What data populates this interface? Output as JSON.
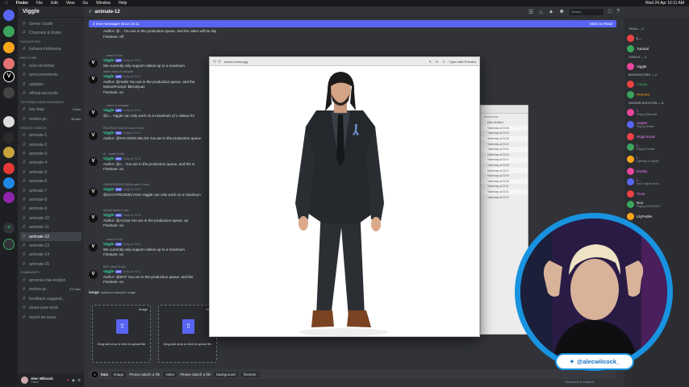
{
  "menubar": {
    "app": "Finder",
    "items": [
      "File",
      "Edit",
      "View",
      "Go",
      "Window",
      "Help"
    ],
    "clock": "Wed 24 Apr 10:11 AM"
  },
  "server": {
    "name": "Viggle"
  },
  "channels": [
    {
      "kind": "ch",
      "label": "Server Guide"
    },
    {
      "kind": "ch",
      "label": "Channels & Roles"
    },
    {
      "kind": "cat",
      "label": "SUGGESTED"
    },
    {
      "kind": "ch",
      "label": "bahasa-indonesia"
    },
    {
      "kind": "cat",
      "label": "WELCOME"
    },
    {
      "kind": "ch",
      "label": "rules-to-follow"
    },
    {
      "kind": "ch",
      "label": "announcements"
    },
    {
      "kind": "ch",
      "label": "updates"
    },
    {
      "kind": "ch",
      "label": "official-accounts"
    },
    {
      "kind": "cat",
      "label": "TUTORIALS AND GUIDANCE"
    },
    {
      "kind": "ch",
      "label": "key-faqs",
      "badge": "6 New"
    },
    {
      "kind": "ch",
      "label": "motion-pr...",
      "badge": "38 New"
    },
    {
      "kind": "cat",
      "label": "CREATE VIDEOS"
    },
    {
      "kind": "ch",
      "label": "animate-1"
    },
    {
      "kind": "ch",
      "label": "animate-2"
    },
    {
      "kind": "ch",
      "label": "animate-3"
    },
    {
      "kind": "ch",
      "label": "animate-4"
    },
    {
      "kind": "ch",
      "label": "animate-5"
    },
    {
      "kind": "ch",
      "label": "animate-6"
    },
    {
      "kind": "ch",
      "label": "animate-7"
    },
    {
      "kind": "ch",
      "label": "animate-8"
    },
    {
      "kind": "ch",
      "label": "animate-9"
    },
    {
      "kind": "ch",
      "label": "animate-10"
    },
    {
      "kind": "ch",
      "label": "animate-11"
    },
    {
      "kind": "ch",
      "label": "animate-12",
      "active": true
    },
    {
      "kind": "ch",
      "label": "animate-13"
    },
    {
      "kind": "ch",
      "label": "animate-14"
    },
    {
      "kind": "ch",
      "label": "animate-15"
    },
    {
      "kind": "cat",
      "label": "COMMUNITY"
    },
    {
      "kind": "ch",
      "label": "general-chat-english"
    },
    {
      "kind": "ch",
      "label": "motion-pr...",
      "badge": "472 New"
    },
    {
      "kind": "ch",
      "label": "feedback-suggesti..."
    },
    {
      "kind": "ch",
      "label": "share-your-work"
    },
    {
      "kind": "ch",
      "label": "report-an-issue"
    }
  ],
  "user": {
    "name": "Alec Wilcock",
    "status": "Online"
  },
  "header": {
    "channel": "animate-12",
    "search": "Search"
  },
  "newbar": {
    "text": "2 new messages since 23:11",
    "mark": "Mark as Read"
  },
  "messages": [
    {
      "reply": "",
      "name": "",
      "time": "",
      "lines": [
        "Author: @... You are in the production queue, and the video will be displayed at this message in 2-5 minutes.  Find my videos on PC  Find my videos on phone",
        "Finetune: off"
      ]
    },
    {
      "reply": "... used /3 mix",
      "name": "Viggle",
      "time": "Today at 23:11",
      "lines": [
        "We currently only support videos up to a maximum"
      ]
    },
    {
      "reply": "maks used /4 animate",
      "name": "Viggle",
      "time": "Today at 23:11",
      "lines": [
        "Author: @maks You are in the production queue, and the",
        "MotionPrompt: $Emeijuan",
        "Finetune: on"
      ]
    },
    {
      "reply": "... used /4 animate",
      "name": "Viggle",
      "time": "Today at 23:11",
      "lines": [
        "@c... Viggle can only work on a maximum of 1 videos for"
      ]
    },
    {
      "reply": "RICARDO MILOS used /4 mix",
      "name": "Viggle",
      "time": "Today at 23:11",
      "lines": [
        "Author: @RICARDO MILOS You are in the production queue"
      ]
    },
    {
      "reply": "A... used /4 mix",
      "name": "Viggle",
      "time": "Today at 23:11",
      "lines": [
        "Author: @c... You are in the production queue, and the vi",
        "Finetune: on"
      ]
    },
    {
      "reply": "GAYATRI23051YANA used /4 mix",
      "name": "Viggle",
      "time": "Today at 23:11",
      "lines": [
        "@GAYATRI23051YANA Viggle can only work on a maximum"
      ]
    },
    {
      "reply": "A1zaa used /4 mix",
      "name": "Viggle",
      "time": "Today at 23:11",
      "lines": [
        "Author: @A1zaa You are in the production queue, an",
        "Finetune: on"
      ]
    },
    {
      "reply": "... used /3 mix",
      "name": "Viggle",
      "time": "Today at 23:11",
      "lines": [
        "We currently only support videos up to a maximum",
        "Finetune: on"
      ]
    },
    {
      "reply": "BHT used /4 mix",
      "name": "Viggle",
      "time": "Today at 23:11",
      "lines": [
        "Author: @BHT You are in the production queue, and the",
        "Finetune: on"
      ]
    }
  ],
  "imagebox": {
    "label": "image",
    "sub": "Upload a character image",
    "drop1_tag": "image",
    "drop2_tag": "video",
    "drop_text": "Drag and drop or click to upload file"
  },
  "cmdbar": {
    "command": "/mix",
    "chips": [
      "image",
      "Please attach a file",
      "video",
      "Please attach a file",
      "background",
      "finetune"
    ]
  },
  "slowmode": "Slowmode is enabled.",
  "viewer": {
    "title": "keanu remov.jpg",
    "open": "Open with Preview"
  },
  "finder": {
    "section": "Downloads",
    "rows": [
      "Date Modified",
      "Yesterday at 23:08",
      "Yesterday at 23:03",
      "Yesterday at 23:06",
      "Yesterday at 23:02",
      "Yesterday at 23:42",
      "Yesterday at 23:44",
      "Yesterday at 23:10",
      "Yesterday at 23:08",
      "Yesterday at 23:12",
      "Yesterday at 23:09",
      "Yesterday at 23:06",
      "Yesterday at 23:01",
      "Yesterday at 23:22",
      "Yesterday at 23:29"
    ]
  },
  "members": [
    {
      "cat": "TEAM — 3"
    },
    {
      "name": "L...",
      "sub": "",
      "color": "#f2f3f5"
    },
    {
      "name": "Tutorial",
      "sub": "",
      "color": "#f2f3f5"
    },
    {
      "cat": "VIGGLE — 1"
    },
    {
      "name": "Viggle",
      "sub": "",
      "color": "#f2f3f5"
    },
    {
      "cat": "MODERATORS — 2"
    },
    {
      "name": "mango",
      "sub": "",
      "color": "#3ba55c"
    },
    {
      "name": "PAPAYA",
      "sub": "",
      "color": "#faa61a"
    },
    {
      "cat": "SERVER BOOSTER — 8"
    },
    {
      "name": "l...",
      "sub": "Playing Minecraft",
      "color": "#f47fff"
    },
    {
      "name": "casper",
      "sub": "Playing Roblox",
      "color": "#f47fff"
    },
    {
      "name": "Hüpp kocar",
      "sub": "",
      "color": "#f47fff"
    },
    {
      "name": "l...",
      "sub": "Playing Fortnite",
      "color": "#f47fff"
    },
    {
      "name": "l...",
      "sub": "Listening to Spotify",
      "color": "#f47fff"
    },
    {
      "name": "boothy",
      "sub": "",
      "color": "#f47fff"
    },
    {
      "name": "l...",
      "sub": "HoYo Fighter Rush",
      "color": "#f47fff"
    },
    {
      "name": "Trust",
      "sub": "",
      "color": "#f47fff"
    },
    {
      "name": "Noo",
      "sub": "Playing VALORANT",
      "color": "#f2f3f5"
    },
    {
      "name": "LilyFedler",
      "sub": "",
      "color": "#f2f3f5"
    }
  ],
  "handle": "@alecwilcock_",
  "colors": {
    "blurple": "#5865f2",
    "bg": "#313338",
    "sidebar": "#2b2d31",
    "ring": "#1893e0"
  }
}
